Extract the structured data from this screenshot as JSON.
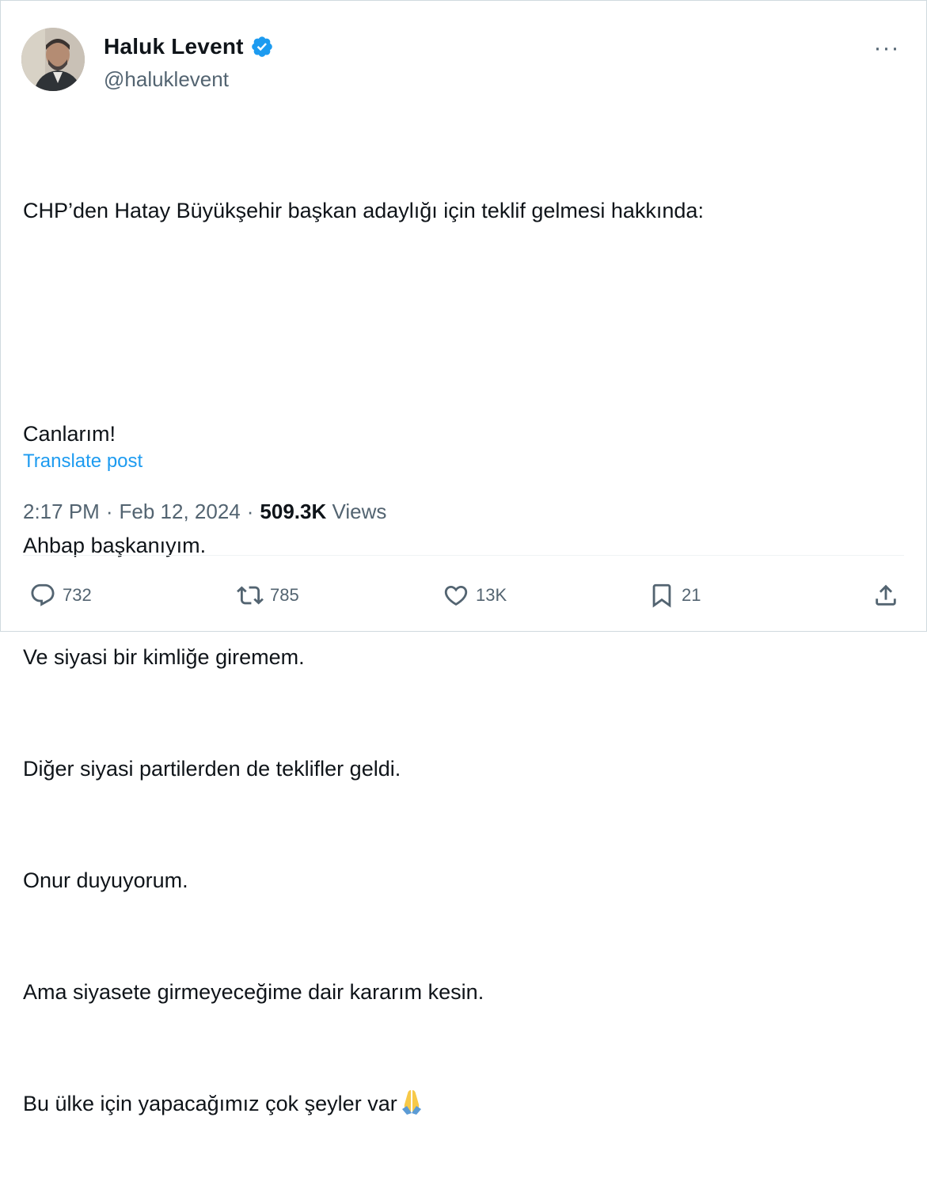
{
  "author": {
    "name": "Haluk Levent",
    "handle": "@haluklevent",
    "verified_color": "#1d9bf0",
    "avatar_icon": "profile-photo"
  },
  "menu": {
    "more_label": "···"
  },
  "post": {
    "lines": [
      "CHP’den Hatay Büyükşehir başkan adaylığı için teklif gelmesi hakkında:",
      "",
      "Canlarım!",
      "Ahbap başkanıyım.",
      "Ve siyasi bir kimliğe giremem.",
      "Diğer siyasi partilerden de teklifler geldi.",
      "Onur duyuyorum.",
      "Ama siyasete girmeyeceğime dair kararım kesin.",
      "Bu ülke için yapacağımız çok şeyler var"
    ],
    "emoji_icon": "folded-hands-emoji",
    "translate_label": "Translate post"
  },
  "meta": {
    "time": "2:17 PM",
    "separator": "·",
    "date": "Feb 12, 2024",
    "views_count": "509.3K",
    "views_label": "Views"
  },
  "actions": {
    "reply_count": "732",
    "repost_count": "785",
    "like_count": "13K",
    "bookmark_count": "21"
  },
  "colors": {
    "text": "#0f1419",
    "secondary": "#536471",
    "accent": "#1d9bf0",
    "border": "#cfd9de"
  }
}
